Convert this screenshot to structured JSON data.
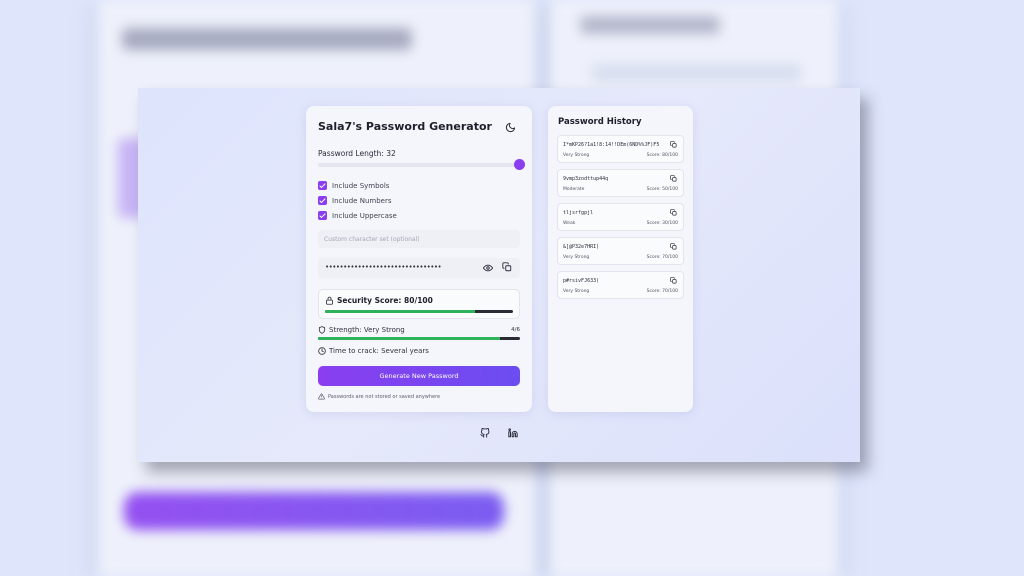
{
  "generator": {
    "title": "Sala7's Password Generator",
    "length_label": "Password Length: 32",
    "length_value": 32,
    "length_fraction": 1.0,
    "options": [
      {
        "label": "Include Symbols",
        "checked": true
      },
      {
        "label": "Include Numbers",
        "checked": true
      },
      {
        "label": "Include Uppercase",
        "checked": true
      }
    ],
    "custom_placeholder": "Custom character set (optional)",
    "password_masked": "••••••••••••••••••••••••••••••••",
    "security_score": "Security Score: 80/100",
    "security_fraction": 0.8,
    "strength": "Strength: Very Strong",
    "strength_count": "4/6",
    "strength_fraction": 0.9,
    "crack_time": "Time to crack: Several years",
    "generate_label": "Generate New Password",
    "note": "Passwords are not stored or saved anywhere"
  },
  "history": {
    "title": "Password History",
    "items": [
      {
        "password": "I*mKP26?1a1!8:14!!DEm(6ND%%JF)F5",
        "strength": "Very Strong",
        "score": "Score: 80/100"
      },
      {
        "password": "9vmp3zodttup44q",
        "strength": "Moderate",
        "score": "Score: 50/100"
      },
      {
        "password": "tljsrfgpjl",
        "strength": "Weak",
        "score": "Score: 30/100"
      },
      {
        "password": "&[@P32e7HRI)",
        "strength": "Very Strong",
        "score": "Score: 70/100"
      },
      {
        "password": "p#rsivFJ633(",
        "strength": "Very Strong",
        "score": "Score: 70/100"
      }
    ]
  },
  "colors": {
    "accent": "#8a3ef0",
    "success": "#2fb35a"
  },
  "icons": {
    "theme": "moon-icon",
    "eye": "eye-icon",
    "copy": "copy-icon",
    "lock": "lock-icon",
    "shield": "shield-icon",
    "clock": "clock-icon",
    "warning": "warning-icon",
    "github": "github-icon",
    "linkedin": "linkedin-icon"
  }
}
